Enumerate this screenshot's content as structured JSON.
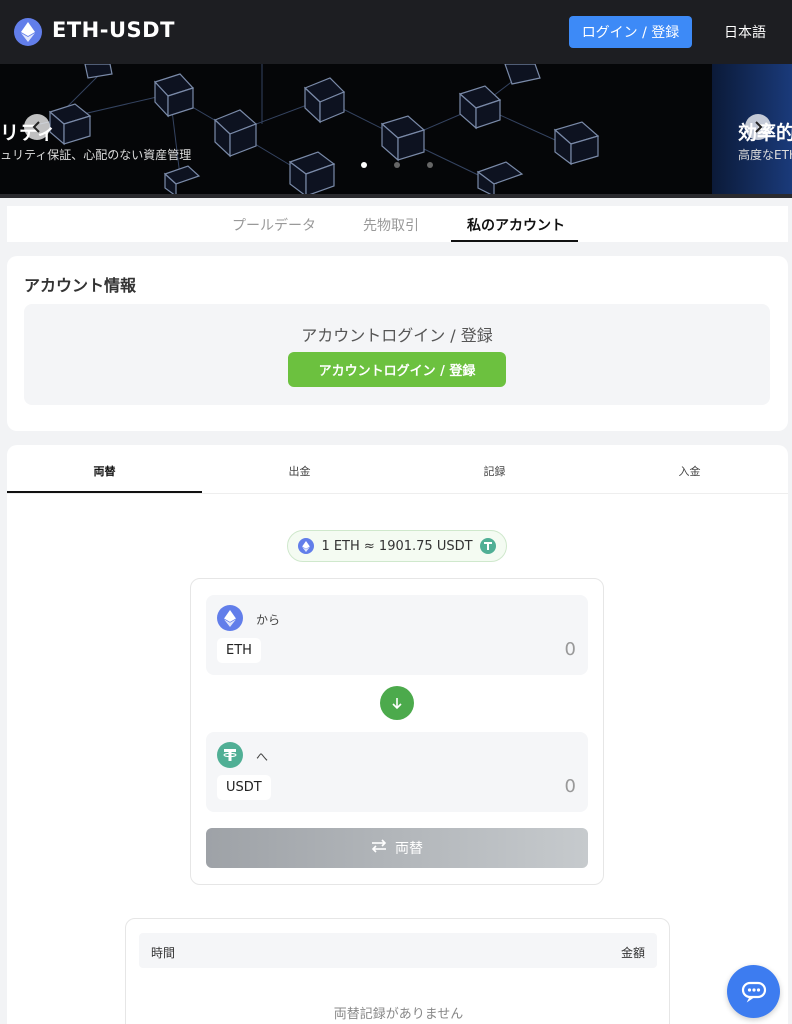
{
  "header": {
    "title": "ETH-USDT",
    "login_label": "ログイン / 登録",
    "language": "日本語"
  },
  "banner": {
    "slide_title": "リティ",
    "slide_subtitle": "ュリティ保証、心配のない資産管理",
    "next_title": "効率的",
    "next_subtitle": "高度なETH",
    "active_dot": 1,
    "dot_count": 3
  },
  "top_tabs": {
    "items": [
      "プールデータ",
      "先物取引",
      "私のアカウント"
    ],
    "active": "私のアカウント"
  },
  "account": {
    "title": "アカウント情報",
    "prompt": "アカウントログイン / 登録",
    "button_label": "アカウントログイン / 登録"
  },
  "exchange_tabs": {
    "items": [
      "両替",
      "出金",
      "記録",
      "入金"
    ],
    "active": "両替"
  },
  "rate": {
    "text": "1 ETH ≈ 1901.75 USDT"
  },
  "swap": {
    "from_label": "から",
    "from_symbol": "ETH",
    "from_amount": "0",
    "to_label": "へ",
    "to_symbol": "USDT",
    "to_amount": "0",
    "button_label": "両替"
  },
  "records": {
    "col_time": "時間",
    "col_amount": "金額",
    "empty_text": "両替記録がありません"
  },
  "colors": {
    "header_bg": "#1d1e22",
    "primary_blue": "#3d8af7",
    "green": "#6cc13f",
    "swap_green": "#4caa4c",
    "eth": "#627eea",
    "usdt": "#50af95"
  },
  "icons": [
    "eth-logo-icon",
    "chevron-left-icon",
    "chevron-right-icon",
    "arrow-down-icon",
    "swap-arrows-icon",
    "usdt-icon",
    "chat-icon"
  ]
}
